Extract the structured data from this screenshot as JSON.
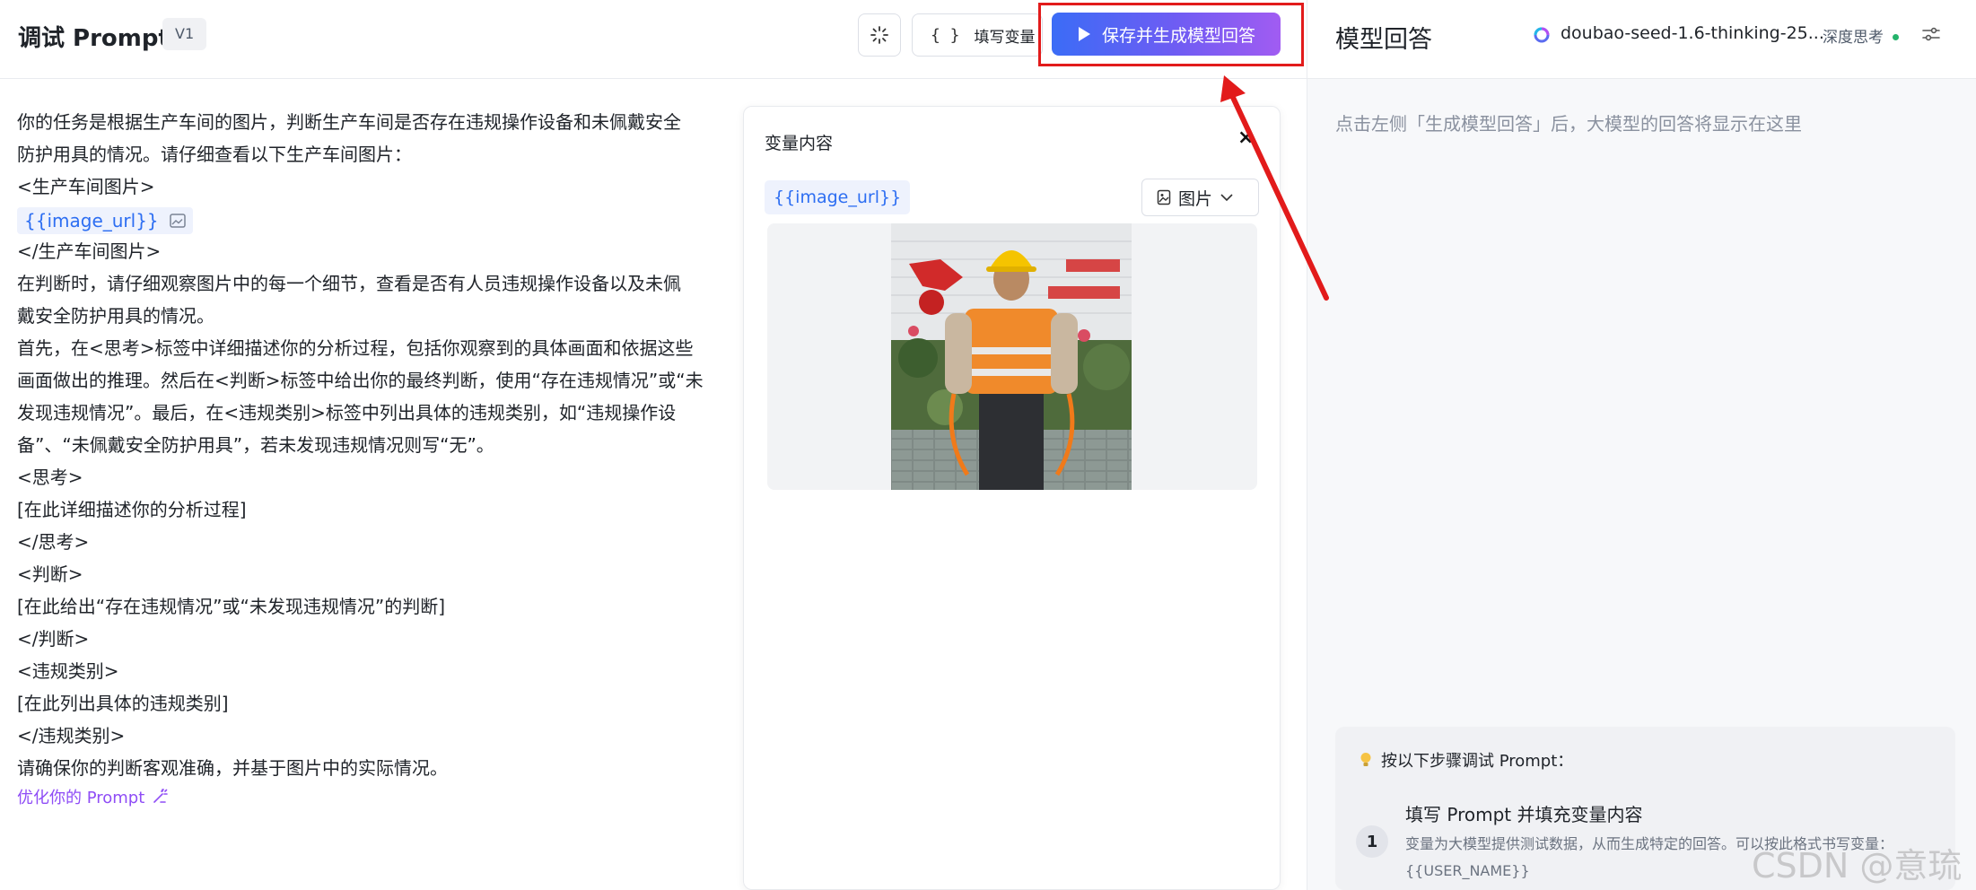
{
  "header": {
    "title": "调试 Prompt",
    "version": "V1",
    "fill_vars_label": "填写变量",
    "save_generate_label": "保存并生成模型回答"
  },
  "prompt": {
    "lines": [
      "你的任务是根据生产车间的图片，判断生产车间是否存在违规操作设备和未佩戴安全",
      "防护用具的情况。请仔细查看以下生产车间图片：",
      "<生产车间图片>",
      "",
      "</生产车间图片>",
      "在判断时，请仔细观察图片中的每一个细节，查看是否有人员违规操作设备以及未佩",
      "戴安全防护用具的情况。",
      "首先，在<思考>标签中详细描述你的分析过程，包括你观察到的具体画面和依据这些",
      "画面做出的推理。然后在<判断>标签中给出你的最终判断，使用“存在违规情况”或“未",
      "发现违规情况”。最后，在<违规类别>标签中列出具体的违规类别，如“违规操作设",
      "备”、“未佩戴安全防护用具”，若未发现违规情况则写“无”。",
      "<思考>",
      "[在此详细描述你的分析过程]",
      "</思考>",
      "<判断>",
      "[在此给出“存在违规情况”或“未发现违规情况”的判断]",
      "</判断>",
      "<违规类别>",
      "[在此列出具体的违规类别]",
      "</违规类别>",
      "请确保你的判断客观准确，并基于图片中的实际情况。"
    ],
    "variable_chip": "{{image_url}}",
    "optimize_link": "优化你的 Prompt"
  },
  "var_card": {
    "title": "变量内容",
    "close": "×",
    "var_name": "{{image_url}}",
    "type_label": "图片"
  },
  "right": {
    "title": "模型回答",
    "model_name": "doubao-seed-1.6-thinking-25...",
    "deep_think": "深度思考",
    "placeholder": "点击左侧「生成模型回答」后，大模型的回答将显示在这里",
    "tips": {
      "head": "按以下步骤调试 Prompt：",
      "step_num": "1",
      "step_title": "填写 Prompt 并填充变量内容",
      "step_desc": "变量为大模型提供测试数据，从而生成特定的回答。可以按此格式书写变量：{{USER_NAME}}"
    }
  },
  "watermark": "CSDN @意琉",
  "colors": {
    "accent_blue": "#2d6ef2",
    "accent_purple": "#8f4df6",
    "highlight_red": "#e21b1b",
    "status_green": "#24b36b"
  }
}
